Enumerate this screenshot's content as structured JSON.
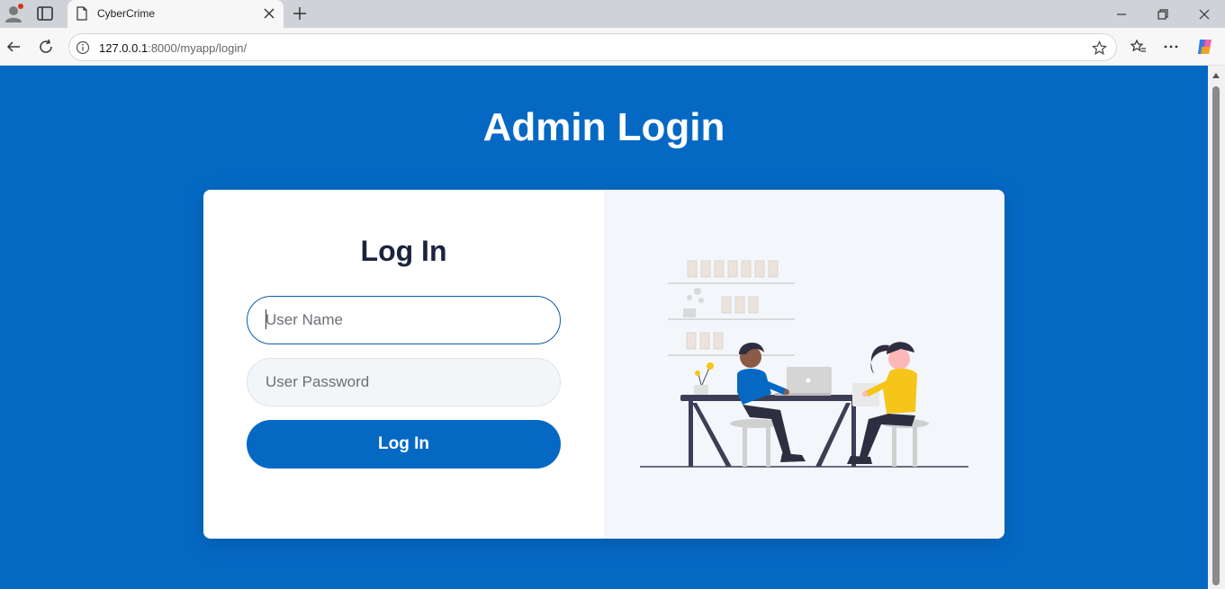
{
  "browser": {
    "tab_title": "CyberCrime",
    "url_host": "127.0.0.1",
    "url_rest": ":8000/myapp/login/",
    "icons": [
      "profile-icon",
      "tab-actions-icon",
      "page-icon",
      "close-icon",
      "plus-icon",
      "minimize-icon",
      "restore-icon",
      "back-icon",
      "refresh-icon",
      "info-icon",
      "star-icon",
      "favorites-icon",
      "more-icon",
      "copilot-icon"
    ]
  },
  "page": {
    "heading": "Admin Login",
    "form_title": "Log In",
    "username_placeholder": "User Name",
    "password_placeholder": "User Password",
    "submit_label": "Log In"
  },
  "colors": {
    "background": "#0569c4",
    "card": "#ffffff",
    "illustration_panel": "#f3f7fb",
    "title_dark": "#1c2340",
    "accent_yellow": "#f5c518"
  }
}
